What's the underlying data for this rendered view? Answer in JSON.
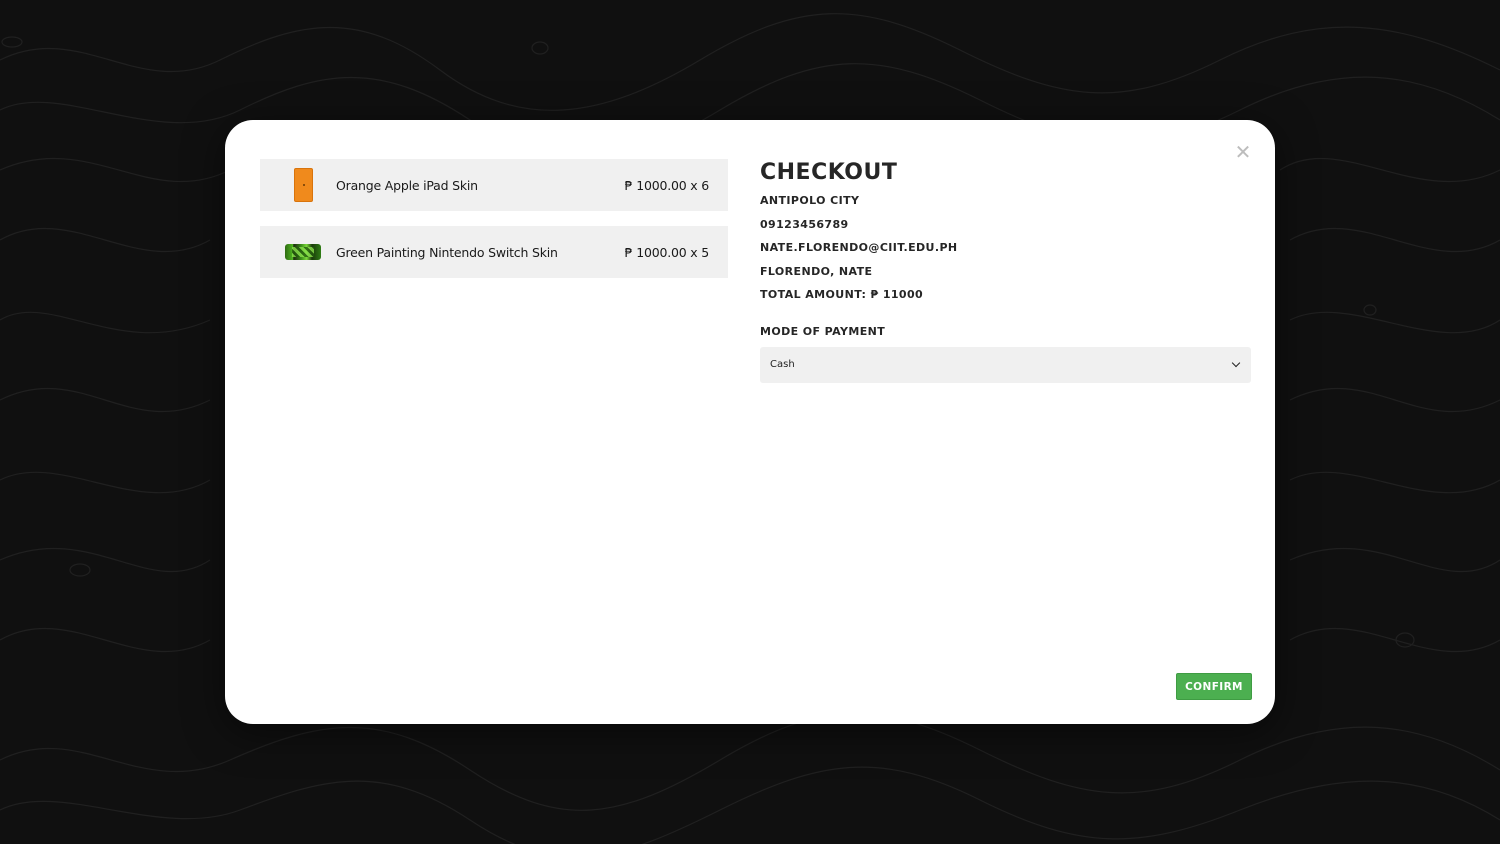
{
  "cart": {
    "items": [
      {
        "name": "Orange Apple iPad Skin",
        "price": "₱ 1000.00 x 6",
        "thumb_icon": "orange-ipad-thumbnail"
      },
      {
        "name": "Green Painting Nintendo Switch Skin",
        "price": "₱ 1000.00 x 5",
        "thumb_icon": "green-switch-thumbnail"
      }
    ]
  },
  "checkout": {
    "title": "CHECKOUT",
    "city": "ANTIPOLO CITY",
    "phone": "09123456789",
    "email": "NATE.FLORENDO@CIIT.EDU.PH",
    "name": "FLORENDO, NATE",
    "total": "TOTAL AMOUNT: ₱ 11000",
    "payment_label": "MODE OF PAYMENT",
    "payment_selected": "Cash",
    "close_icon": "close-icon",
    "confirm_label": "CONFIRM"
  },
  "colors": {
    "backdrop": "#101010",
    "modal": "#ffffff",
    "item_bg": "#f0f0f0",
    "confirm": "#4caf50",
    "text": "#262626"
  }
}
